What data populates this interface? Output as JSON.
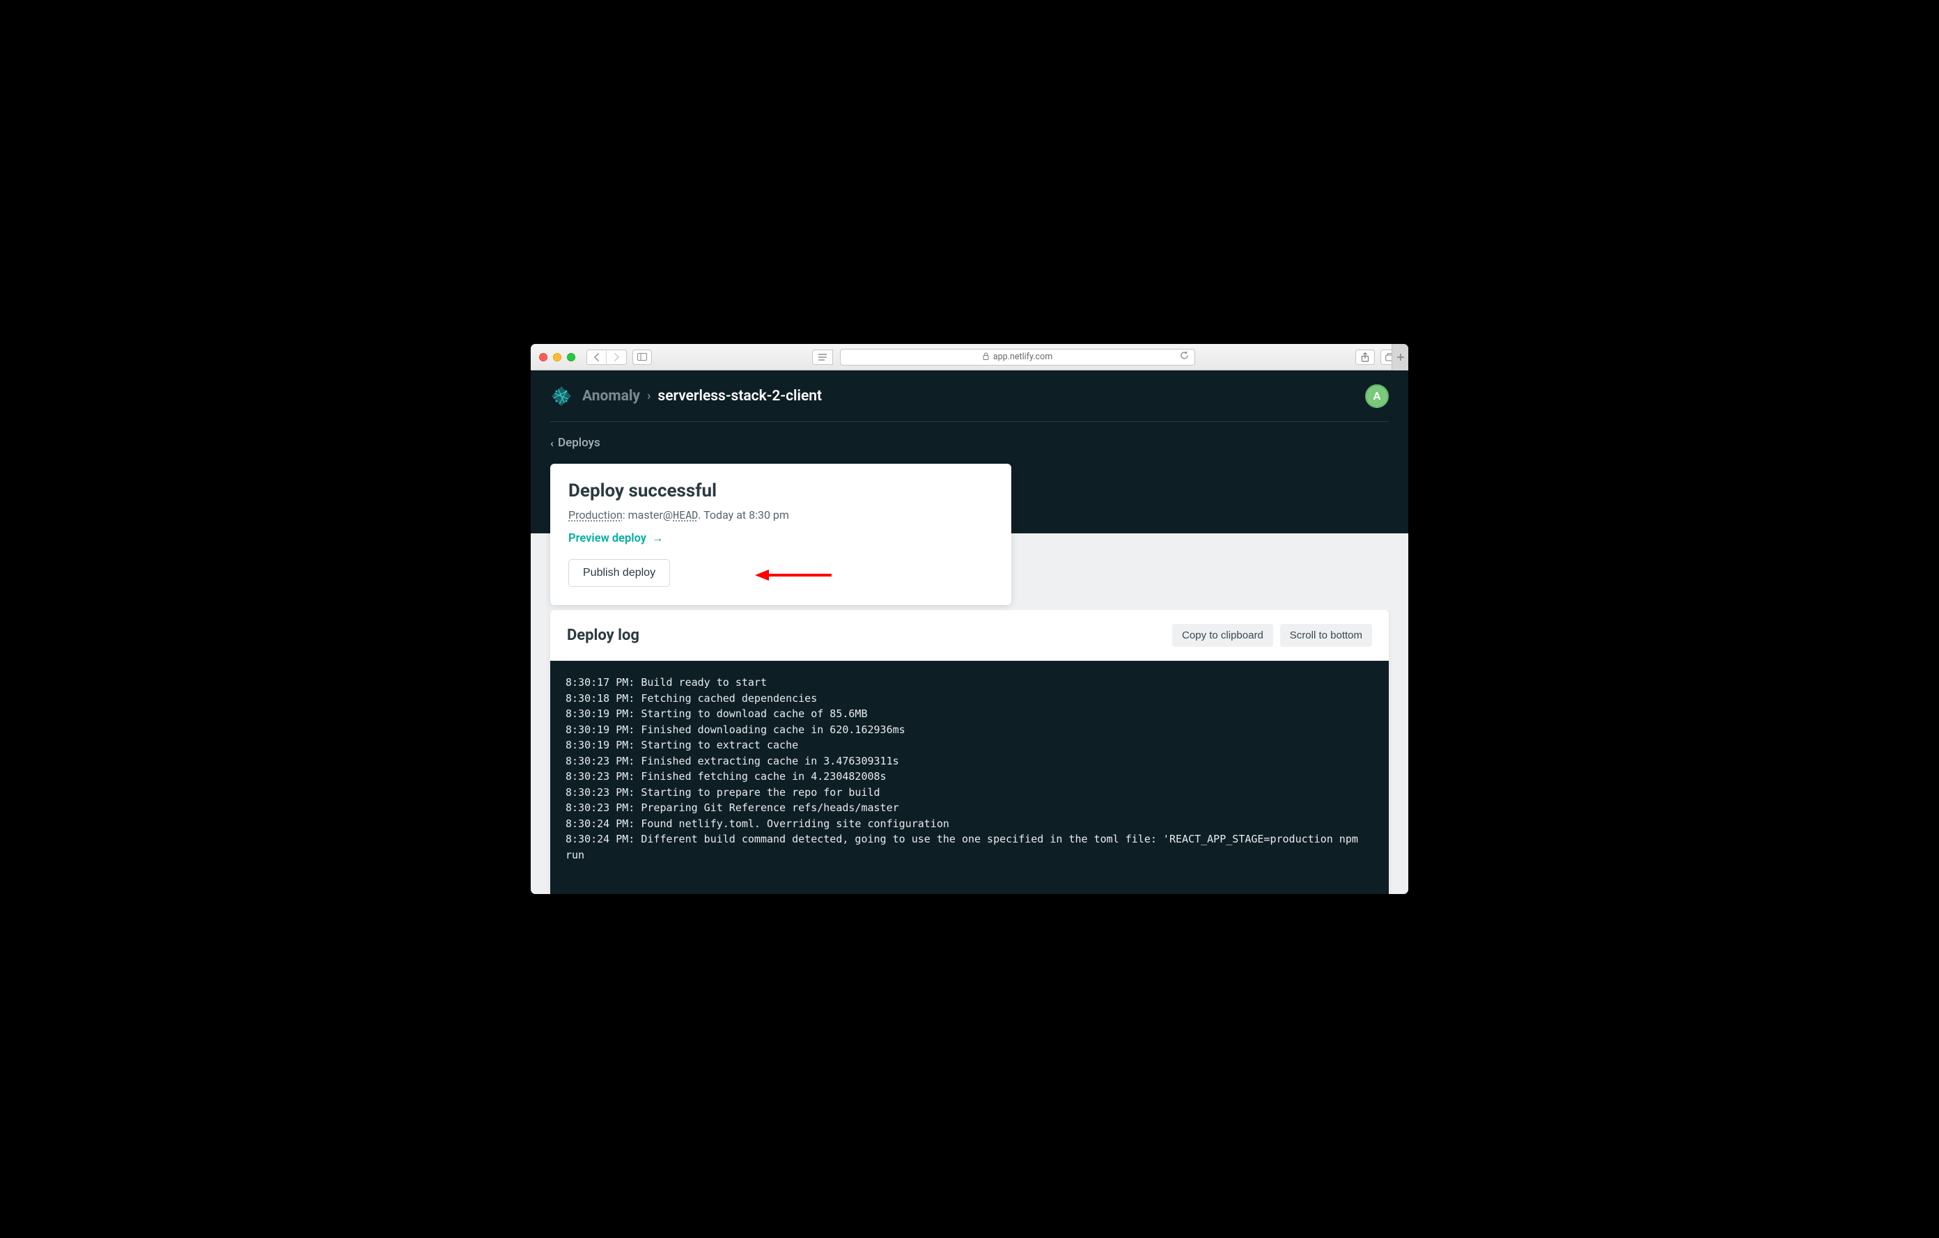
{
  "browser": {
    "url_host": "app.netlify.com"
  },
  "nav": {
    "org": "Anomaly",
    "site": "serverless-stack-2-client",
    "avatar_letter": "A",
    "back_label": "Deploys"
  },
  "summary": {
    "title": "Deploy successful",
    "env_label": "Production",
    "branch": "master",
    "ref": "HEAD",
    "time_text": "Today at 8:30 pm",
    "preview_label": "Preview deploy",
    "publish_label": "Publish deploy"
  },
  "log": {
    "title": "Deploy log",
    "copy_label": "Copy to clipboard",
    "scroll_label": "Scroll to bottom",
    "lines": [
      "8:30:17 PM: Build ready to start",
      "8:30:18 PM: Fetching cached dependencies",
      "8:30:19 PM: Starting to download cache of 85.6MB",
      "8:30:19 PM: Finished downloading cache in 620.162936ms",
      "8:30:19 PM: Starting to extract cache",
      "8:30:23 PM: Finished extracting cache in 3.476309311s",
      "8:30:23 PM: Finished fetching cache in 4.230482008s",
      "8:30:23 PM: Starting to prepare the repo for build",
      "8:30:23 PM: Preparing Git Reference refs/heads/master",
      "8:30:24 PM: Found netlify.toml. Overriding site configuration",
      "8:30:24 PM: Different build command detected, going to use the one specified in the toml file: 'REACT_APP_STAGE=production npm run"
    ]
  }
}
